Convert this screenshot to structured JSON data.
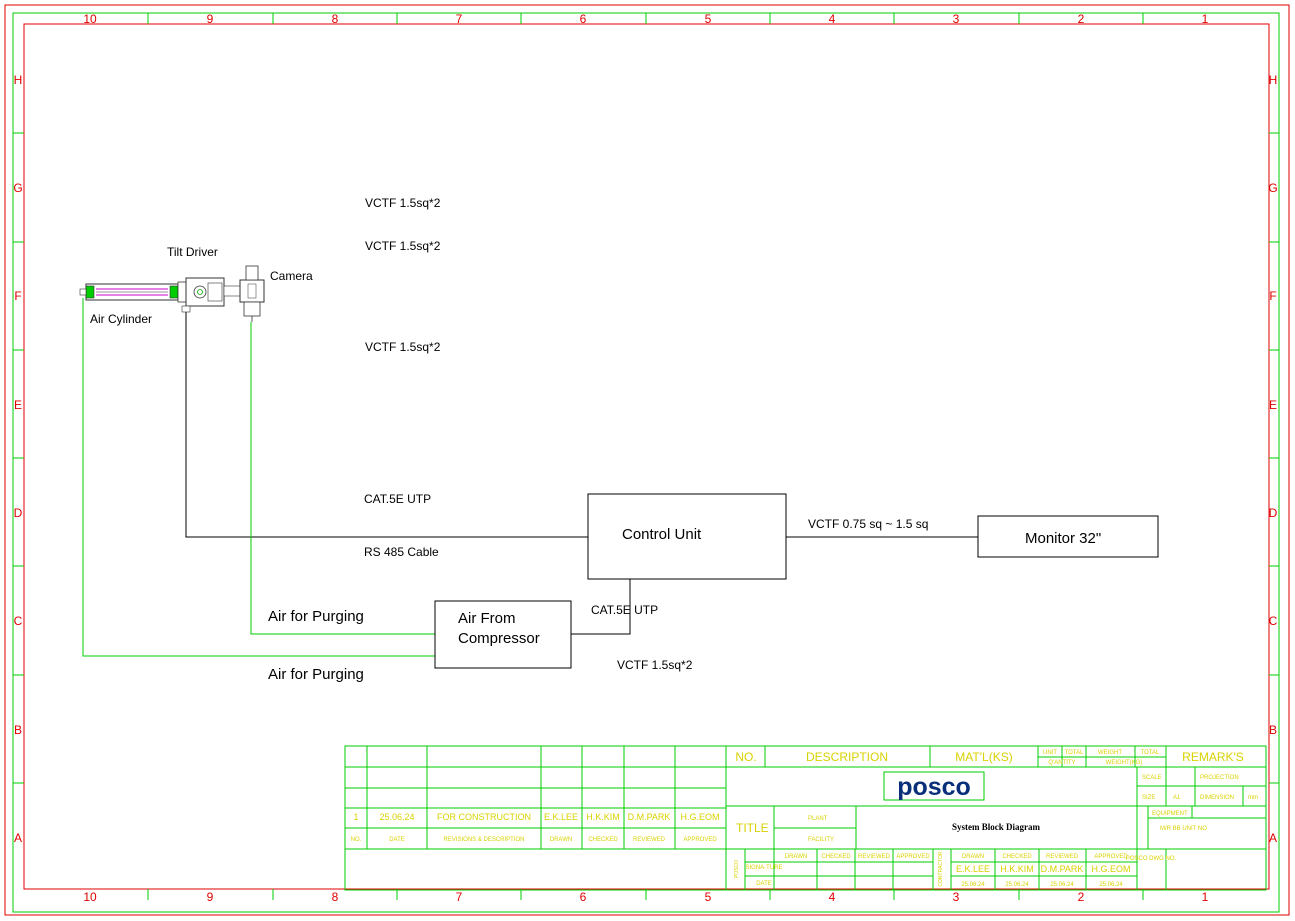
{
  "frame": {
    "columns": [
      "10",
      "9",
      "8",
      "7",
      "6",
      "5",
      "4",
      "3",
      "2",
      "1"
    ],
    "rows": [
      "H",
      "G",
      "F",
      "E",
      "D",
      "C",
      "B",
      "A"
    ]
  },
  "components": {
    "tilt_driver": "Tilt Driver",
    "camera": "Camera",
    "air_cylinder": "Air Cylinder",
    "control_unit": "Control Unit",
    "monitor": "Monitor 32\"",
    "air_compressor_line1": "Air From",
    "air_compressor_line2": "Compressor"
  },
  "cables": {
    "vctf_1": "VCTF 1.5sq*2",
    "vctf_2": "VCTF 1.5sq*2",
    "vctf_3": "VCTF 1.5sq*2",
    "cat5e_1": "CAT.5E UTP",
    "rs485": "RS 485 Cable",
    "vctf_monitor": "VCTF  0.75 sq ~ 1.5 sq",
    "cat5e_2": "CAT.5E UTP",
    "vctf_4": "VCTF 1.5sq*2",
    "air_purge_1": "Air for Purging",
    "air_purge_2": "Air for Purging"
  },
  "title_block": {
    "revision": {
      "no": "1",
      "date": "25.06.24",
      "description": "FOR  CONSTRUCTION",
      "drawn": "E.K.LEE",
      "checked": "H.K.KIM",
      "reviewed": "D.M.PARK",
      "approved": "H.G.EOM"
    },
    "rev_headers": {
      "no": "NO.",
      "date": "DATE",
      "description": "REVISIONS  &  DESCRIPTION",
      "drawn": "DRAWN",
      "checked": "CHECKED",
      "reviewed": "REVIEWED",
      "approved": "APPROVED"
    },
    "parts_headers": {
      "no": "NO.",
      "description": "DESCRIPTION",
      "mat": "MAT'L(KS)",
      "unit": "UNIT",
      "total": "TOTAL",
      "q_ty": "Q'ANTITY",
      "weight": "WEIGHT",
      "weight_kg": "WEIGHT(KG)",
      "total2": "TOTAL",
      "remarks": "REMARK'S"
    },
    "logo": "posco",
    "scale_label": "SCALE",
    "projection_label": "PROJECTION",
    "size_label": "SIZE",
    "size_value": "A1",
    "dimension_label": "DIMENSION",
    "dimension_value": "mm",
    "title_label": "TITLE",
    "plant_label": "PLANT",
    "facility_label": "FACILITY",
    "drawing_title": "System  Block  Diagram",
    "equipment_label": "EQUIPMENT",
    "mr_unit_label": "M/R BB UNIT NO",
    "sign_headers": {
      "drawn": "DRAWN",
      "checked": "CHECKED",
      "reviewed": "REVIEWED",
      "approved": "APPROVED"
    },
    "posco_label": "POSCO",
    "contractor_label": "CONTRACTOR",
    "sign_name_label": "SIGNA-TURE",
    "sign_date_label": "DATE",
    "contractor_names": {
      "drawn": "E.K.LEE",
      "checked": "H.K.KIM",
      "reviewed": "D.M.PARK",
      "approved": "H.G.EOM"
    },
    "contractor_dates": {
      "drawn": "25.06.24",
      "checked": "25.06.24",
      "reviewed": "25.06.24",
      "approved": "25.06.24"
    },
    "posco_dwg_label": "POSCO DWG NO."
  },
  "colors": {
    "frame_outer": "#e00000",
    "frame_inner": "#00cc00",
    "title_text": "#d9d200",
    "wire": "#000000",
    "air_line": "#00cc00",
    "logo": "#0a2f7a"
  }
}
